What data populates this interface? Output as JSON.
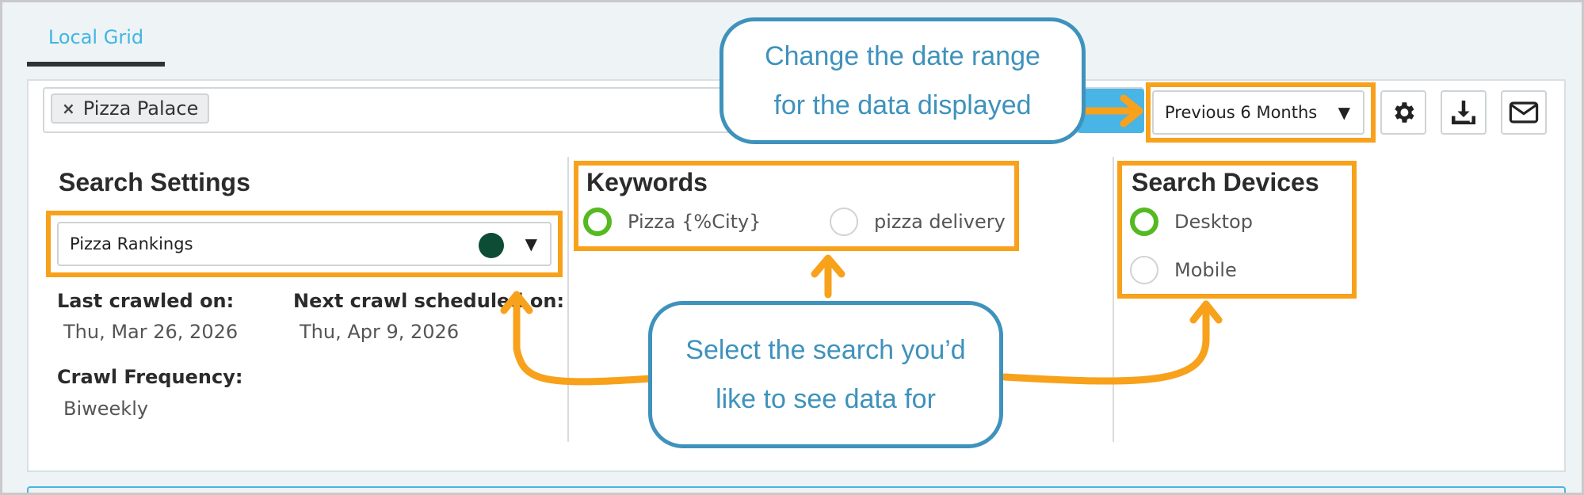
{
  "tab": {
    "label": "Local Grid"
  },
  "filter": {
    "chip_label": "Pizza Palace",
    "chip_remove": "×"
  },
  "date_range": {
    "selected": "Previous 6 Months",
    "caret": "▼"
  },
  "search_settings": {
    "title": "Search Settings",
    "selected_search": "Pizza Rankings",
    "caret": "▼",
    "status_color": "#0d4d35",
    "last_crawled_label": "Last crawled on:",
    "last_crawled_value": "Thu, Mar 26, 2026",
    "next_crawl_label": "Next crawl scheduled on:",
    "next_crawl_value": "Thu, Apr 9, 2026",
    "frequency_label": "Crawl Frequency:",
    "frequency_value": "Biweekly"
  },
  "keywords": {
    "title": "Keywords",
    "options": [
      {
        "label": "Pizza {%City}",
        "selected": true
      },
      {
        "label": "pizza delivery",
        "selected": false
      }
    ]
  },
  "search_devices": {
    "title": "Search Devices",
    "options": [
      {
        "label": "Desktop",
        "selected": true
      },
      {
        "label": "Mobile",
        "selected": false
      }
    ]
  },
  "toolbar_icons": [
    "gear-icon",
    "download-icon",
    "mail-icon"
  ],
  "callouts": {
    "date_range": [
      "Change the date range",
      "for the data displayed"
    ],
    "search": [
      "Select the search you’d",
      "like to see data for"
    ]
  },
  "colors": {
    "accent": "#49b4e6",
    "highlight": "#f8a11b",
    "callout": "#3e92bc",
    "radio_on": "#55b921"
  }
}
